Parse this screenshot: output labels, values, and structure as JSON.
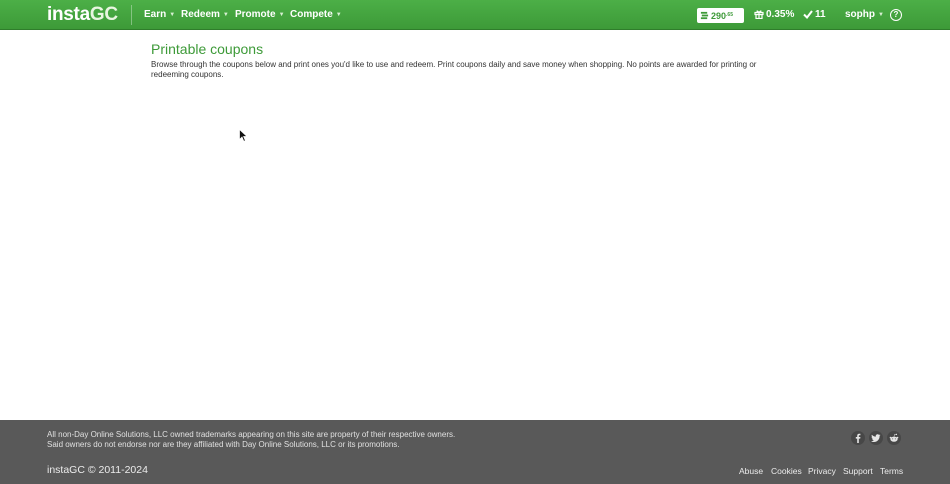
{
  "header": {
    "logo_main": "insta",
    "logo_accent": "GC",
    "nav": [
      {
        "label": "Earn"
      },
      {
        "label": "Redeem"
      },
      {
        "label": "Promote"
      },
      {
        "label": "Compete"
      }
    ],
    "points": "290",
    "points_cents": ".65",
    "bonus_rate": "0.35%",
    "completed_count": "11",
    "username": "sophp",
    "help_glyph": "?"
  },
  "main": {
    "title": "Printable coupons",
    "description": "Browse through the coupons below and print ones you'd like to use and redeem. Print coupons daily and save money when shopping. No points are awarded for printing or redeeming coupons."
  },
  "footer": {
    "notice_line1": "All non-Day Online Solutions, LLC owned trademarks appearing on this site are property of their respective owners.",
    "notice_line2": "Said owners do not endorse nor are they affiliated with Day Online Solutions, LLC or its promotions.",
    "copyright": "instaGC © 2011-2024",
    "links": [
      "Abuse",
      "Cookies",
      "Privacy",
      "Support",
      "Terms"
    ],
    "social": [
      "facebook-icon",
      "twitter-icon",
      "reddit-icon"
    ]
  },
  "colors": {
    "brand_green": "#3d9a38",
    "header_green": "#4caf47",
    "footer_gray": "#595959"
  }
}
